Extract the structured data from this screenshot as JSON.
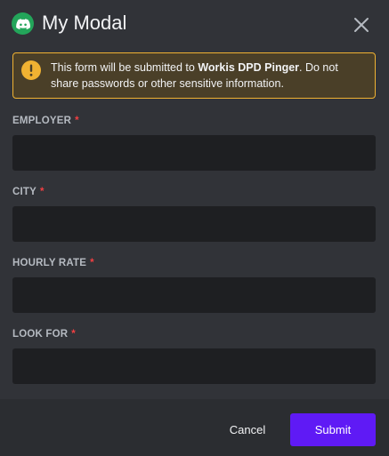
{
  "header": {
    "title": "My Modal",
    "app_icon": "discord-logo-icon",
    "close_icon": "close-icon"
  },
  "warning": {
    "icon": "exclamation-icon",
    "text_before": "This form will be submitted to ",
    "app_name": "Workis DPD Pinger",
    "text_after": ". Do not share passwords or other sensitive information."
  },
  "fields": [
    {
      "label": "EMPLOYER",
      "required_marker": "*",
      "value": ""
    },
    {
      "label": "CITY",
      "required_marker": "*",
      "value": ""
    },
    {
      "label": "HOURLY RATE",
      "required_marker": "*",
      "value": ""
    },
    {
      "label": "LOOK FOR",
      "required_marker": "*",
      "value": ""
    }
  ],
  "footer": {
    "cancel_label": "Cancel",
    "submit_label": "Submit"
  },
  "colors": {
    "background": "#313338",
    "footer": "#2b2d31",
    "input": "#1e1f22",
    "warning_border": "#f0b232",
    "warning_bg": "#4a3f28",
    "brand_green": "#23a55a",
    "submit": "#5f1af5",
    "required": "#f23f42"
  }
}
